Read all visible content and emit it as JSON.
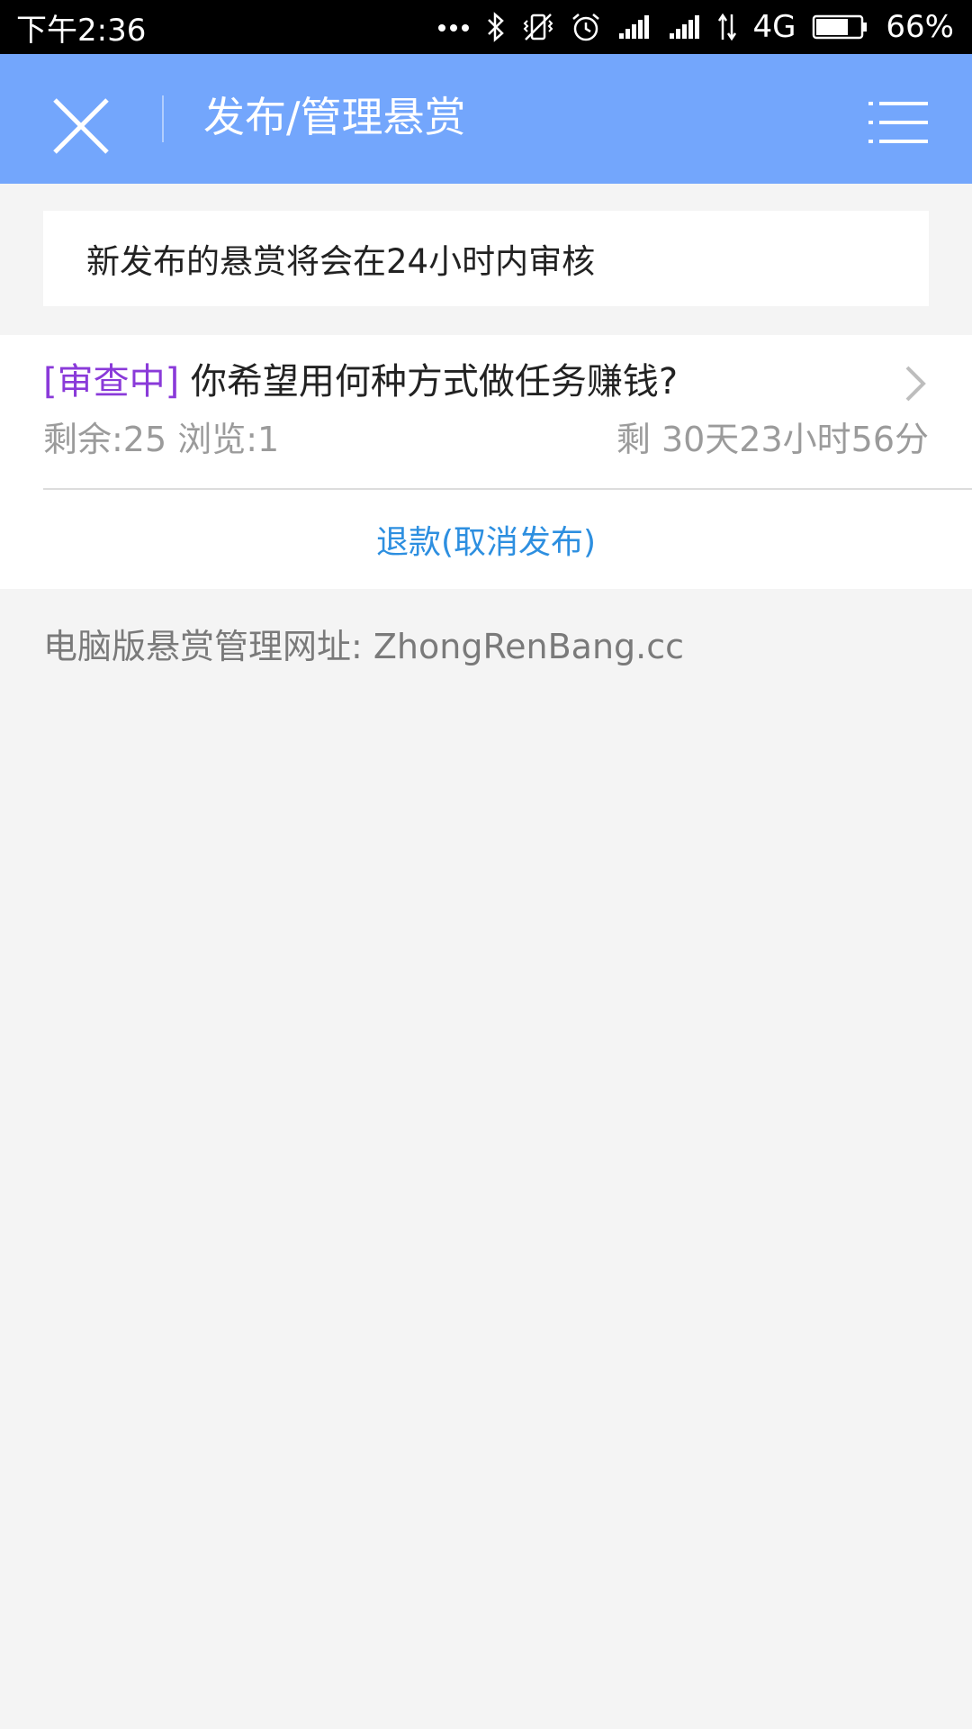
{
  "status_bar": {
    "time": "下午2:36",
    "network": "4G",
    "battery": "66%",
    "icons": [
      "more-dots-icon",
      "bluetooth-icon",
      "vibrate-off-icon",
      "alarm-icon",
      "signal-icon",
      "signal-icon",
      "data-arrows-icon",
      "battery-icon"
    ]
  },
  "header": {
    "title": "发布/管理悬赏",
    "close_icon": "close-icon",
    "menu_icon": "list-menu-icon",
    "background_color": "#73a6fc"
  },
  "notice": {
    "text": "新发布的悬赏将会在24小时内审核"
  },
  "bounty": {
    "status_tag": "[审查中]",
    "title": " 你希望用何种方式做任务赚钱?",
    "remaining_label": "剩余:25 浏览:1",
    "time_left": "剩 30天23小时56分",
    "refund_label": "退款(取消发布)",
    "status_color": "#8a3ad9",
    "link_color": "#2d8fe0"
  },
  "footer": {
    "text": "电脑版悬赏管理网址: ZhongRenBang.cc"
  }
}
